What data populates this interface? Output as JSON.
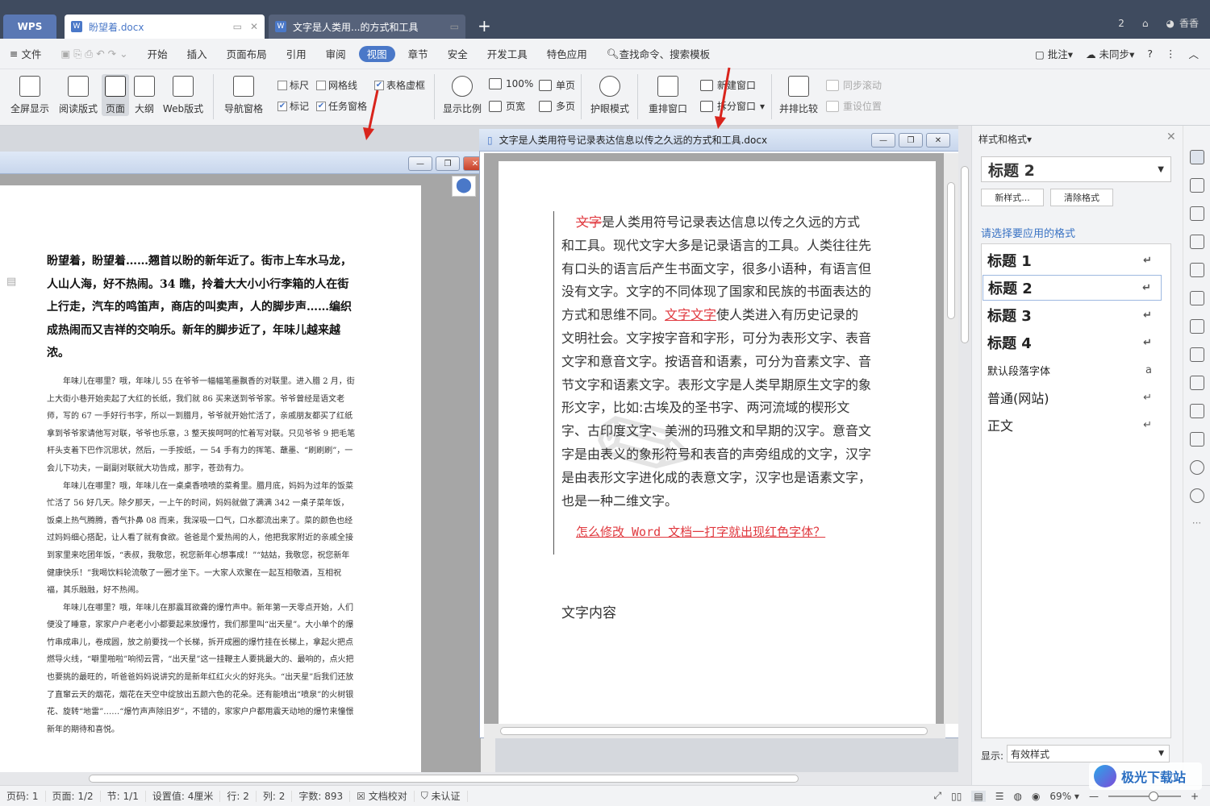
{
  "tabs": {
    "wps": "WPS",
    "doc1": "盼望着.docx",
    "doc2": "文字是人类用...的方式和工具",
    "user": "香香"
  },
  "menu": [
    "文件",
    "开始",
    "插入",
    "页面布局",
    "引用",
    "审阅",
    "视图",
    "章节",
    "安全",
    "开发工具",
    "特色应用"
  ],
  "search": "查找命令、搜索模板",
  "menu_right": {
    "comment": "批注",
    "sync": "未同步"
  },
  "ribbon": {
    "fullscreen": "全屏显示",
    "read": "阅读版式",
    "page": "页面",
    "outline": "大纲",
    "web": "Web版式",
    "nav": "导航窗格",
    "ruler": "标尺",
    "grid": "网格线",
    "tableframe": "表格虚框",
    "marks": "标记",
    "taskpane": "任务窗格",
    "zoom": "显示比例",
    "percent": "100%",
    "pagewidth": "页宽",
    "single": "单页",
    "multi": "多页",
    "eyecare": "护眼模式",
    "arrange": "重排窗口",
    "newwin": "新建窗口",
    "split": "拆分窗口",
    "sidebyside": "并排比较",
    "syncscroll": "同步滚动",
    "resetpos": "重设位置"
  },
  "right_doc_title": "文字是人类用符号记录表达信息以传之久远的方式和工具.docx",
  "left_doc": {
    "heading": "盼望着，盼望着……翘首以盼的新年近了。街市上车水马龙，人山人海，好不热闹。34 瞧，拎着大大小小行李箱的人在街上行走，汽车的鸣笛声，商店的叫卖声，人的脚步声……编织成热闹而又吉祥的交响乐。新年的脚步近了，年味儿越来越浓。",
    "p1": "年味儿在哪里？哦，年味儿 55 在爷爷一幅幅笔墨飘香的对联里。进入腊 2 月，街上大街小巷开始卖起了大红的长纸，我们就 86 买来送到爷爷家。爷爷曾经是语文老师，写的 67 一手好行书字，所以一到腊月，爷爷就开始忙活了，亲戚朋友都买了红纸拿到爷爷家请他写对联，爷爷也乐意，3 整天挨呵呵的忙着写对联。只见爷爷 9 把毛笔杆头支着下巴作沉思状，然后，一手按纸，一 54 手有力的挥笔、蘸墨、“刷刷刷”，一会儿下功夫，一副副对联就大功告成，那字，苍劲有力。",
    "p2": "年味儿在哪里？哦，年味儿在一桌桌香喷喷的菜肴里。腊月底，妈妈为过年的饭菜忙活了 56 好几天。除夕那天，一上午的时间，妈妈就做了满满 342 一桌子菜年饭，饭桌上热气腾腾，香气扑鼻 08 而来，我深吸一口气，口水都流出来了。菜的颜色也经过妈妈细心搭配，让人看了就有食欲。爸爸是个爱热闹的人，他把我家附近的亲戚全接到家里来吃团年饭，“表叔，我敬您，祝您新年心想事成！”“姑姑，我敬您，祝您新年健康快乐！”我喝饮料轮流敬了一圈才坐下。一大家人欢聚在一起互相敬酒，互相祝福，其乐融融，好不热闹。",
    "p3": "年味儿在哪里？哦，年味儿在那震耳欲聋的爆竹声中。新年第一天零点开始，人们便没了睡意，家家户户老老小小都要起来放爆竹，我们那里叫“出天星”。大小单个的爆竹串成串儿，卷成圆，放之前要找一个长梯，拆开成圈的爆竹挂在长梯上，拿起火把点燃导火线，“噼里啪啦”响彻云霄，“出天星”这一挂鞭主人要挑最大的、最响的，点火把也要挑的最旺的，听爸爸妈妈说讲究的是新年红红火火的好兆头。“出天星”后我们还放了直窜云天的烟花，烟花在天空中绽放出五颜六色的花朵。还有能喷出“喷泉”的火树银花、旋转“地雷”……“爆竹声声除旧岁”，不错的，家家户户都用震天动地的爆竹来憧憬新年的期待和喜悦。"
  },
  "right_doc": {
    "strike": "文字",
    "t1": "是人类用符号记录表达信息以传之久远的方式和工具。现代文字大多是记录语言的工具。人类往往先有口头的语言后产生书面文字，很多小语种，有语言但没有文字。文字的不同体现了国家和民族的书面表达的方式和思维不同。",
    "under": "文字文字",
    "t2": "使人类进入有历史记录的文明社会。文字按字音和字形，可分为表形文字、表音文字和意音文字。按语音和语素，可分为音素文字、音节文字和语素文字。表形文字是人类早期原生文字的象形文字，比如:古埃及的圣书字、两河流域的楔形文字、古印度文字、美洲的玛雅文和早期的汉字。意音文字是由表义的象形符号和表音的声旁组成的文字，汉字是由表形文字进化成的表意文字，汉字也是语素文字，也是一种二维文字。",
    "link": "怎么修改 Word 文档一打字就出现红色字体？",
    "content": "文字内容"
  },
  "styles_panel": {
    "title": "样式和格式",
    "current": "标题  2",
    "new_style": "新样式...",
    "clear": "清除格式",
    "prompt": "请选择要应用的格式",
    "items": [
      "标题  1",
      "标题  2",
      "标题  3",
      "标题  4",
      "默认段落字体",
      "普通(网站)",
      "正文"
    ],
    "show_label": "显示:",
    "show_value": "有效样式"
  },
  "status": {
    "pagecode": "页码: 1",
    "page": "页面: 1/2",
    "section": "节: 1/1",
    "setting": "设置值: 4厘米",
    "row": "行: 2",
    "col": "列: 2",
    "words": "字数: 893",
    "proof": "文档校对",
    "cert": "未认证",
    "zoom": "69%"
  },
  "watermark": "极光下载站",
  "colors": {
    "accent": "#4a78c8",
    "red": "#e0383e",
    "tabbar": "#3f4b5f"
  }
}
